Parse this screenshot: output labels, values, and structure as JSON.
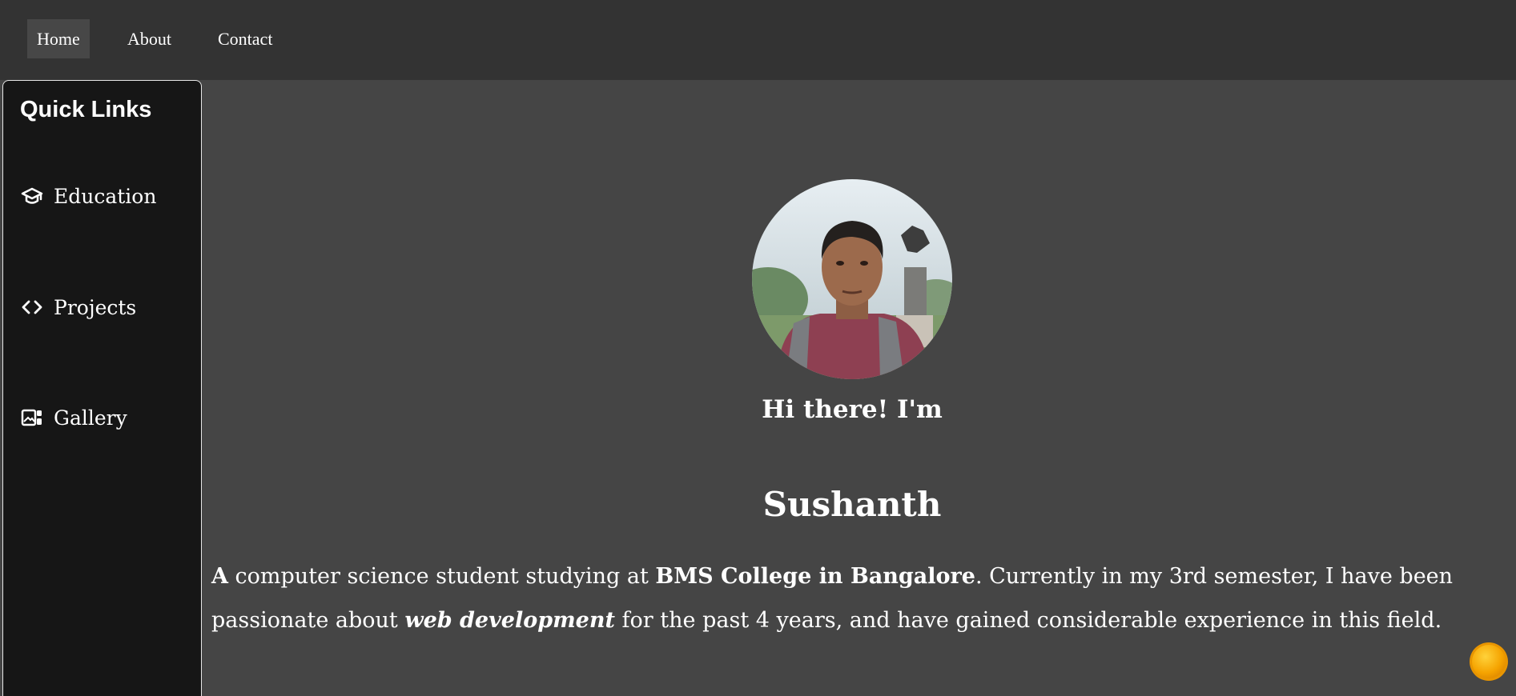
{
  "nav": {
    "home": "Home",
    "about": "About",
    "contact": "Contact"
  },
  "sidebar": {
    "title": "Quick Links",
    "items": [
      {
        "label": "Education",
        "icon": "graduation-cap-icon"
      },
      {
        "label": "Projects",
        "icon": "code-icon"
      },
      {
        "label": "Gallery",
        "icon": "gallery-icon"
      }
    ]
  },
  "hero": {
    "greeting": "Hi there! I'm",
    "name": "Sushanth",
    "bio": {
      "p1": "A",
      "p2": " computer science student studying at ",
      "p3": "BMS College in Bangalore",
      "p4": ". Currently in my 3rd semester, I have been passionate about ",
      "p5": "web development",
      "p6": " for the past 4 years, and have gained considerable experience in this field."
    }
  },
  "colors": {
    "topbar": "#333333",
    "page_bg": "#454545",
    "sidebar_bg": "#161616",
    "active_nav": "#474747",
    "sun": "#f5a300"
  },
  "theme_toggle_icon": "sun-icon"
}
